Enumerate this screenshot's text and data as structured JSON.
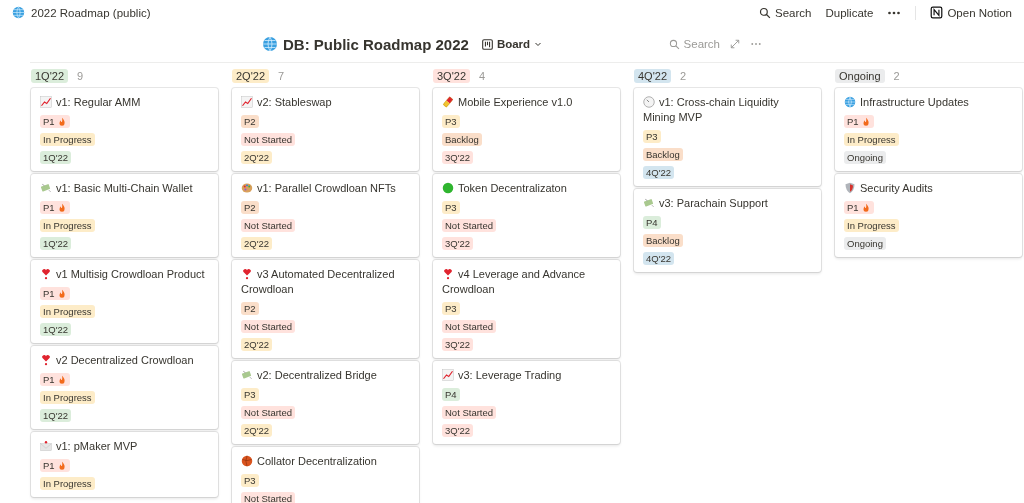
{
  "topbar": {
    "title": "2022 Roadmap (public)",
    "actions": [
      {
        "label": "Search",
        "kind": "search"
      },
      {
        "label": "Duplicate",
        "kind": "plain"
      },
      {
        "kind": "more"
      },
      {
        "label": "Open Notion",
        "kind": "notion"
      }
    ]
  },
  "database": {
    "title": "DB: Public Roadmap 2022",
    "view": "Board",
    "search": "Search"
  },
  "columns": [
    {
      "label": "1Q'22",
      "count": "9",
      "color": "#dbeddb",
      "cards": [
        {
          "kind": "chart",
          "title": "v1: Regular AMM",
          "tags": [
            {
              "text": "P1",
              "color": "#ffe2dd",
              "flame": true
            },
            {
              "text": "In Progress",
              "color": "#fdecc8"
            },
            {
              "text": "1Q'22",
              "color": "#dbeddb"
            }
          ]
        },
        {
          "kind": "money",
          "title": "v1: Basic Multi-Chain Wallet",
          "tags": [
            {
              "text": "P1",
              "color": "#ffe2dd",
              "flame": true
            },
            {
              "text": "In Progress",
              "color": "#fdecc8"
            },
            {
              "text": "1Q'22",
              "color": "#dbeddb"
            }
          ]
        },
        {
          "kind": "heart",
          "title": "v1 Multisig Crowdloan Product",
          "tags": [
            {
              "text": "P1",
              "color": "#ffe2dd",
              "flame": true
            },
            {
              "text": "In Progress",
              "color": "#fdecc8"
            },
            {
              "text": "1Q'22",
              "color": "#dbeddb"
            }
          ]
        },
        {
          "kind": "heart",
          "title": "v2 Decentralized Crowdloan",
          "tags": [
            {
              "text": "P1",
              "color": "#ffe2dd",
              "flame": true
            },
            {
              "text": "In Progress",
              "color": "#fdecc8"
            },
            {
              "text": "1Q'22",
              "color": "#dbeddb"
            }
          ]
        },
        {
          "kind": "envelope",
          "title": "v1: pMaker MVP",
          "tags": [
            {
              "text": "P1",
              "color": "#ffe2dd",
              "flame": true
            },
            {
              "text": "In Progress",
              "color": "#fdecc8"
            }
          ]
        }
      ]
    },
    {
      "label": "2Q'22",
      "count": "7",
      "color": "#fdecc8",
      "cards": [
        {
          "kind": "chart",
          "title": "v2: Stableswap",
          "tags": [
            {
              "text": "P2",
              "color": "#fadec9",
              "flame": false
            },
            {
              "text": "Not Started",
              "color": "#ffe2dd"
            },
            {
              "text": "2Q'22",
              "color": "#fdecc8"
            }
          ]
        },
        {
          "kind": "palette",
          "title": "v1: Parallel Crowdloan NFTs",
          "tags": [
            {
              "text": "P2",
              "color": "#fadec9",
              "flame": false
            },
            {
              "text": "Not Started",
              "color": "#ffe2dd"
            },
            {
              "text": "2Q'22",
              "color": "#fdecc8"
            }
          ]
        },
        {
          "kind": "heart",
          "title": "v3 Automated Decentralized Crowdloan",
          "tags": [
            {
              "text": "P2",
              "color": "#fadec9",
              "flame": false
            },
            {
              "text": "Not Started",
              "color": "#ffe2dd"
            },
            {
              "text": "2Q'22",
              "color": "#fdecc8"
            }
          ]
        },
        {
          "kind": "money",
          "title": "v2: Decentralized Bridge",
          "tags": [
            {
              "text": "P3",
              "color": "#fdecc8",
              "flame": false
            },
            {
              "text": "Not Started",
              "color": "#ffe2dd"
            },
            {
              "text": "2Q'22",
              "color": "#fdecc8"
            }
          ]
        },
        {
          "kind": "ball",
          "title": "Collator Decentralization",
          "tags": [
            {
              "text": "P3",
              "color": "#fdecc8",
              "flame": false
            },
            {
              "text": "Not Started",
              "color": "#ffe2dd"
            }
          ]
        }
      ]
    },
    {
      "label": "3Q'22",
      "count": "4",
      "color": "#ffe2dd",
      "cards": [
        {
          "kind": "pill",
          "title": "Mobile Experience v1.0",
          "tags": [
            {
              "text": "P3",
              "color": "#fdecc8",
              "flame": false
            },
            {
              "text": "Backlog",
              "color": "#fadec9"
            },
            {
              "text": "3Q'22",
              "color": "#ffe2dd"
            }
          ]
        },
        {
          "kind": "dot",
          "title": "Token Decentralizaton",
          "tags": [
            {
              "text": "P3",
              "color": "#fdecc8",
              "flame": false
            },
            {
              "text": "Not Started",
              "color": "#ffe2dd"
            },
            {
              "text": "3Q'22",
              "color": "#ffe2dd"
            }
          ]
        },
        {
          "kind": "heart",
          "title": "v4 Leverage and Advance Crowdloan",
          "tags": [
            {
              "text": "P3",
              "color": "#fdecc8",
              "flame": false
            },
            {
              "text": "Not Started",
              "color": "#ffe2dd"
            },
            {
              "text": "3Q'22",
              "color": "#ffe2dd"
            }
          ]
        },
        {
          "kind": "chart",
          "title": "v3: Leverage Trading",
          "tags": [
            {
              "text": "P4",
              "color": "#dbeddb",
              "flame": false
            },
            {
              "text": "Not Started",
              "color": "#ffe2dd"
            },
            {
              "text": "3Q'22",
              "color": "#ffe2dd"
            }
          ]
        }
      ]
    },
    {
      "label": "4Q'22",
      "count": "2",
      "color": "#d3e5ef",
      "cards": [
        {
          "kind": "dial",
          "title": "v1: Cross-chain Liquidity Mining MVP",
          "tags": [
            {
              "text": "P3",
              "color": "#fdecc8",
              "flame": false
            },
            {
              "text": "Backlog",
              "color": "#fadec9"
            },
            {
              "text": "4Q'22",
              "color": "#d3e5ef"
            }
          ]
        },
        {
          "kind": "money",
          "title": "v3: Parachain Support",
          "tags": [
            {
              "text": "P4",
              "color": "#dbeddb",
              "flame": false
            },
            {
              "text": "Backlog",
              "color": "#fadec9"
            },
            {
              "text": "4Q'22",
              "color": "#d3e5ef"
            }
          ]
        }
      ]
    },
    {
      "label": "Ongoing",
      "count": "2",
      "color": "#ebeced",
      "cards": [
        {
          "kind": "globe",
          "title": "Infrastructure Updates",
          "tags": [
            {
              "text": "P1",
              "color": "#ffe2dd",
              "flame": true
            },
            {
              "text": "In Progress",
              "color": "#fdecc8"
            },
            {
              "text": "Ongoing",
              "color": "#ebeced"
            }
          ]
        },
        {
          "kind": "shield",
          "title": "Security Audits",
          "tags": [
            {
              "text": "P1",
              "color": "#ffe2dd",
              "flame": true
            },
            {
              "text": "In Progress",
              "color": "#fdecc8"
            },
            {
              "text": "Ongoing",
              "color": "#ebeced"
            }
          ]
        }
      ]
    }
  ]
}
